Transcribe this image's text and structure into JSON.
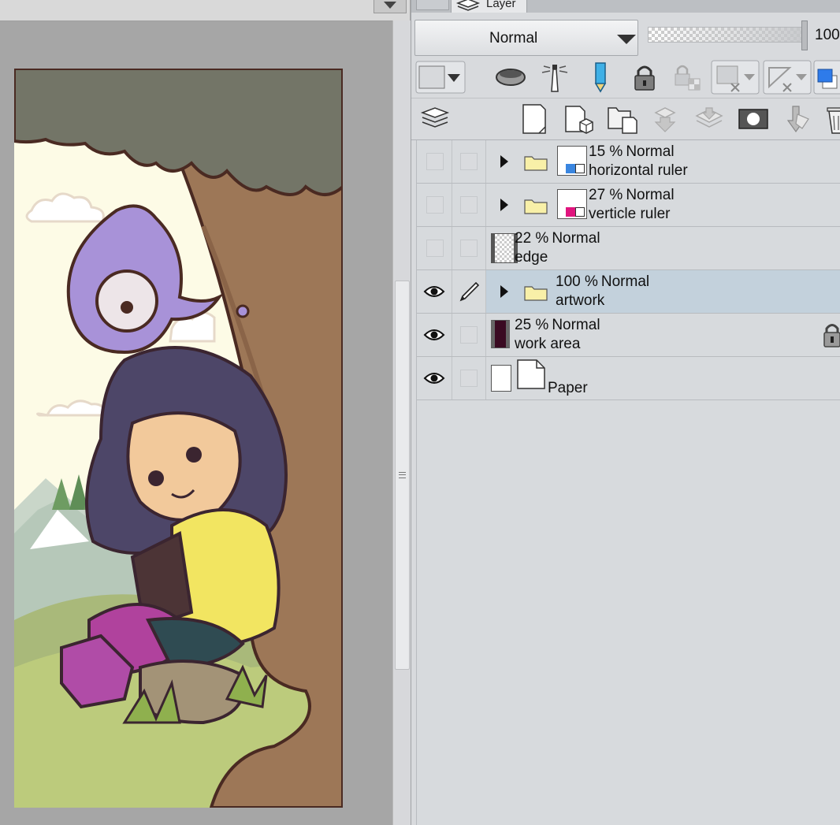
{
  "panel": {
    "tab_title": "Layer"
  },
  "blend": {
    "mode": "Normal",
    "opacity": "100"
  },
  "icons": {
    "toolbar1": [
      "layer-color-dropdown-icon",
      "paint-bucket-reference-icon",
      "lighthouse-reference-icon",
      "pencil-draft-icon",
      "lock-layer-icon",
      "lock-transparent-icon",
      "mask-enable-icon",
      "ruler-enable-icon",
      "layer-color-icon"
    ],
    "toolbar2": [
      "layer-stack-icon",
      "new-raster-layer-icon",
      "new-vector-layer-icon",
      "new-folder-icon",
      "transfer-down-icon",
      "merge-down-icon",
      "layer-mask-icon",
      "transfer-mask-icon",
      "delete-layer-icon"
    ]
  },
  "layers": [
    {
      "opacity": "15 %",
      "mode": "Normal",
      "name": "horizontal ruler",
      "visible": false,
      "folder": true,
      "selected": false,
      "locked": false,
      "thumb": "ruler-blue"
    },
    {
      "opacity": "27 %",
      "mode": "Normal",
      "name": "verticle ruler",
      "visible": false,
      "folder": true,
      "selected": false,
      "locked": false,
      "thumb": "ruler-pink"
    },
    {
      "opacity": "22 %",
      "mode": "Normal",
      "name": "edge",
      "visible": false,
      "folder": false,
      "selected": false,
      "locked": false,
      "thumb": "edge"
    },
    {
      "opacity": "100 %",
      "mode": "Normal",
      "name": "artwork",
      "visible": true,
      "folder": true,
      "selected": true,
      "locked": false,
      "thumb": "none"
    },
    {
      "opacity": "25 %",
      "mode": "Normal",
      "name": "work area",
      "visible": true,
      "folder": false,
      "selected": false,
      "locked": true,
      "thumb": "work-area"
    },
    {
      "opacity": "",
      "mode": "",
      "name": "Paper",
      "visible": true,
      "folder": false,
      "selected": false,
      "locked": false,
      "thumb": "paper"
    }
  ],
  "colors": {
    "selected_row": "#c3d1dc",
    "panel_bg": "#d8dadd",
    "canvas_bg": "#a6a6a6"
  }
}
